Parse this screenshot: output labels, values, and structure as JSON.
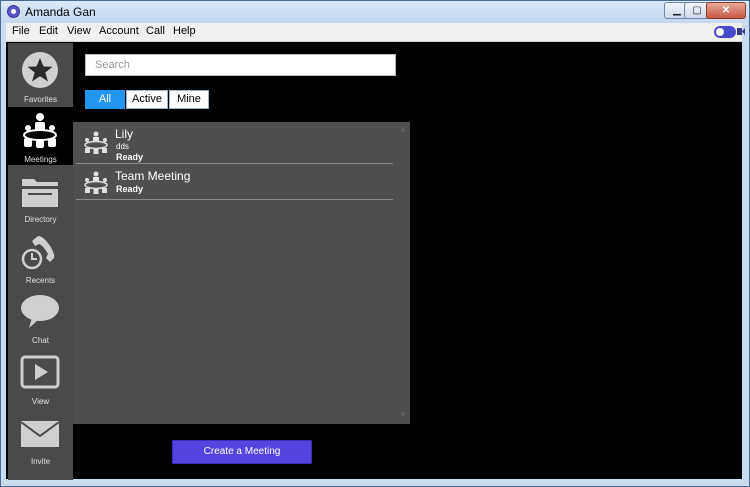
{
  "window": {
    "title": "Amanda Gan"
  },
  "menubar": {
    "items": [
      "File",
      "Edit",
      "View",
      "Account",
      "Call",
      "Help"
    ]
  },
  "sidebar": {
    "items": [
      {
        "label": "Favorites",
        "icon": "star-icon"
      },
      {
        "label": "Meetings",
        "icon": "meetings-icon",
        "active": true
      },
      {
        "label": "Directory",
        "icon": "folder-icon"
      },
      {
        "label": "Recents",
        "icon": "phone-clock-icon"
      },
      {
        "label": "Chat",
        "icon": "chat-bubble-icon"
      },
      {
        "label": "View",
        "icon": "play-icon"
      },
      {
        "label": "Invite",
        "icon": "envelope-icon"
      }
    ]
  },
  "search": {
    "placeholder": "Search"
  },
  "filters": {
    "all": "All",
    "active": "Active",
    "mine": "Mine",
    "selected": "All"
  },
  "meetings": [
    {
      "name": "Lily",
      "description": "dds",
      "status": "Ready"
    },
    {
      "name": "Team Meeting",
      "status": "Ready"
    }
  ],
  "actions": {
    "create_meeting": "Create a Meeting"
  },
  "colors": {
    "accent": "#5544e0",
    "filter_selected": "#2196f3",
    "sidebar": "#4a4a4a",
    "list_bg": "#4f4f4f"
  }
}
